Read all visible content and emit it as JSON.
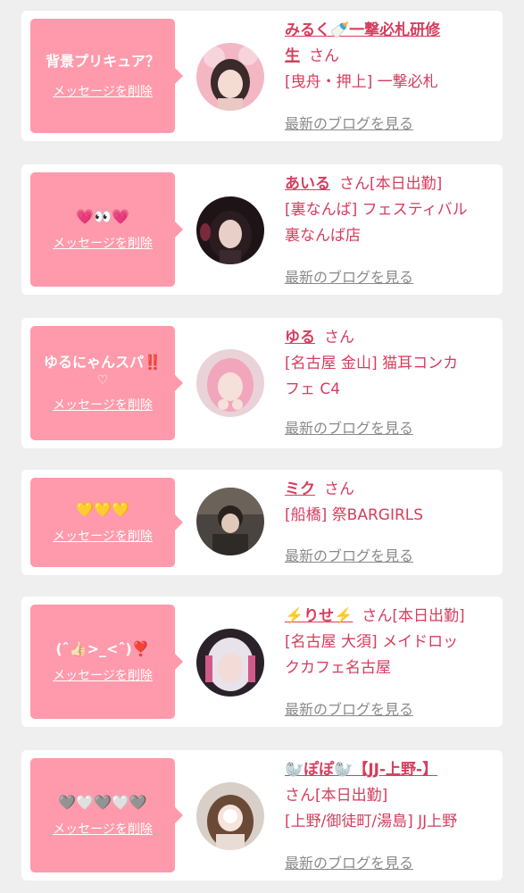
{
  "colors": {
    "bubble": "#fe9aab",
    "accent": "#d63d5e",
    "muted": "#8a8a8a",
    "background": "#efefef"
  },
  "common": {
    "delete_label": "メッセージを削除",
    "blog_label": "最新のブログを見る",
    "san": "さん"
  },
  "cards": [
    {
      "message": "背景プリキュア？",
      "message_sub": "",
      "name_line1": "みるく🍼一撃必札研修",
      "name_line2": "生",
      "status": "",
      "location_line1": "[曳舟・押上] 一撃必札",
      "location_line2": ""
    },
    {
      "message": "💗👀💗",
      "message_sub": "",
      "name_line1": "あいる",
      "name_line2": "",
      "status": "[本日出勤]",
      "location_line1": "[裏なんば] フェスティバル",
      "location_line2": "裏なんば店"
    },
    {
      "message": "ゆるにゃんスパ‼️",
      "message_sub": "♡",
      "name_line1": "ゆる",
      "name_line2": "",
      "status": "",
      "location_line1": "[名古屋 金山] 猫耳コンカ",
      "location_line2": "フェ C4"
    },
    {
      "message": "💛💛💛",
      "message_sub": "",
      "name_line1": "ミク",
      "name_line2": "",
      "status": "",
      "location_line1": "[船橋] 祭BARGIRLS",
      "location_line2": ""
    },
    {
      "message": "(ˆ👍🏻>_<ˆ)❣️",
      "message_sub": "",
      "name_line1": "⚡️りせ⚡️",
      "name_line2": "",
      "status": "[本日出勤]",
      "location_line1": "[名古屋 大須] メイドロッ",
      "location_line2": "クカフェ名古屋"
    },
    {
      "message": "🩶🤍🩶🤍🩶",
      "message_sub": "",
      "name_line1": "🦭ぽぽ🦭【JJ-上野-】",
      "name_line2": "",
      "status": "[本日出勤]",
      "location_line1": "[上野/御徒町/湯島] JJ上野",
      "location_line2": ""
    }
  ]
}
